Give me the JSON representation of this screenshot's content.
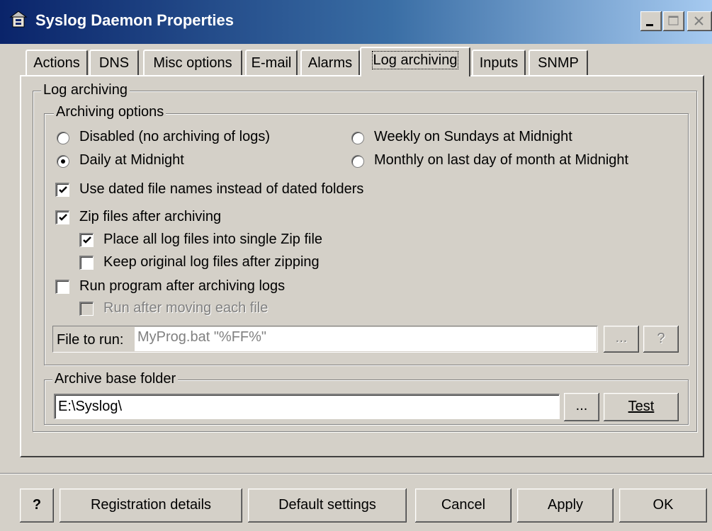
{
  "window": {
    "title": "Syslog Daemon Properties",
    "icon": "app-icon"
  },
  "tabs": [
    {
      "label": "Actions"
    },
    {
      "label": "DNS"
    },
    {
      "label": "Misc options"
    },
    {
      "label": "E-mail"
    },
    {
      "label": "Alarms"
    },
    {
      "label": "Log archiving",
      "active": true
    },
    {
      "label": "Inputs"
    },
    {
      "label": "SNMP"
    }
  ],
  "log_archiving": {
    "group_label": "Log archiving",
    "options_label": "Archiving options",
    "radios": {
      "disabled": {
        "label": "Disabled (no archiving of logs)",
        "checked": false
      },
      "daily": {
        "label": "Daily at Midnight",
        "checked": true
      },
      "weekly": {
        "label": "Weekly on Sundays at Midnight",
        "checked": false
      },
      "monthly": {
        "label": "Monthly on last day of month at Midnight",
        "checked": false
      }
    },
    "checkboxes": {
      "dated_names": {
        "label": "Use dated file names instead of dated folders",
        "checked": true
      },
      "zip": {
        "label": "Zip files after archiving",
        "checked": true
      },
      "single_zip": {
        "label": "Place all log files into single Zip file",
        "checked": true
      },
      "keep_original": {
        "label": "Keep original log files after zipping",
        "checked": false
      },
      "run_program": {
        "label": "Run program after archiving logs",
        "checked": false
      },
      "run_each": {
        "label": "Run after moving each file",
        "checked": false,
        "disabled": true
      }
    },
    "file_to_run": {
      "label": "File to run:",
      "value": "MyProg.bat \"%FF%\"",
      "browse": "...",
      "help": "?"
    },
    "archive_folder": {
      "label": "Archive base folder",
      "value": "E:\\Syslog\\",
      "browse": "...",
      "test": "Test"
    }
  },
  "footer": {
    "help": "?",
    "registration": "Registration details",
    "defaults": "Default settings",
    "cancel": "Cancel",
    "apply": "Apply",
    "ok": "OK"
  }
}
